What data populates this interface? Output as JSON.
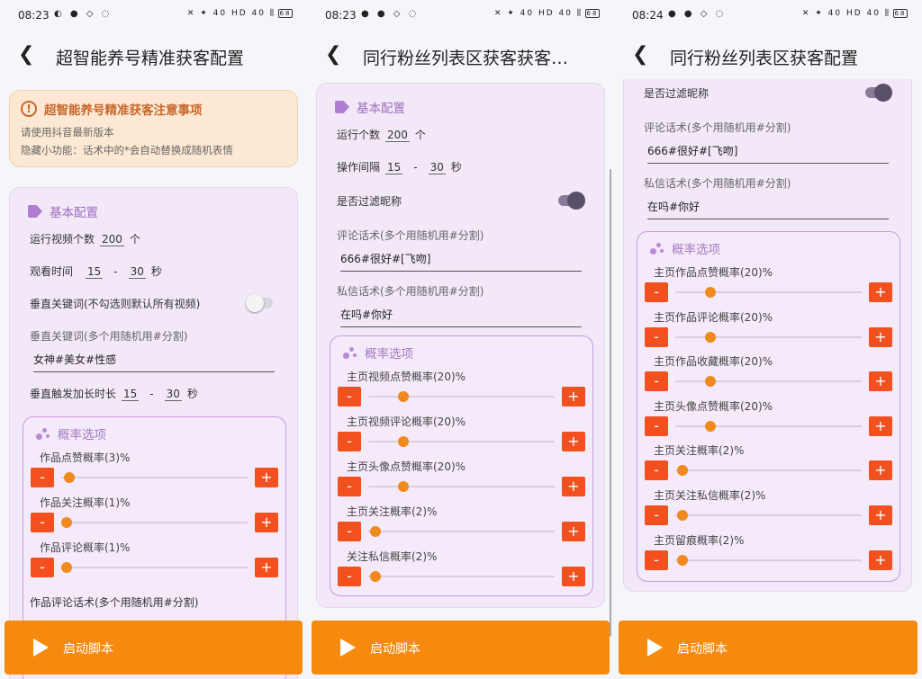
{
  "screens": [
    {
      "status": {
        "time": "08:23",
        "left_icons": "◐ ● ◇ ◌",
        "right_icons": "✕ ✦ 40 HD 40 ⫼",
        "battery": "68"
      },
      "title": "超智能养号精准获客配置",
      "notice": {
        "title": "超智能养号精准获客注意事项",
        "line1": "请使用抖音最新版本",
        "line2": "隐藏小功能：话术中的*会自动替换成随机表情"
      },
      "basic": {
        "title": "基本配置",
        "run_count_label": "运行视频个数",
        "run_count": "200",
        "run_count_unit": "个",
        "watch_label": "观看时间",
        "watch_min": "15",
        "watch_dash": "-",
        "watch_max": "30",
        "watch_unit": "秒",
        "vertical_kw_label": "垂直关键词(不勾选则默认所有视频)",
        "vertical_kw_on": false,
        "kw_field_label": "垂直关键词(多个用随机用#分割)",
        "kw_field_value": "女神#美女#性感",
        "trigger_label": "垂直触发加长时长",
        "trigger_min": "15",
        "trigger_dash": "-",
        "trigger_max": "30",
        "trigger_unit": "秒"
      },
      "prob": {
        "title": "概率选项",
        "items": [
          {
            "label": "作品点赞概率(3)%",
            "value": 3
          },
          {
            "label": "作品关注概率(1)%",
            "value": 1
          },
          {
            "label": "作品评论概率(1)%",
            "value": 1
          }
        ],
        "minus": "-",
        "plus": "+"
      },
      "comment_label": "作品评论话术(多个用随机用#分割)",
      "start_label": "启动脚本"
    },
    {
      "status": {
        "time": "08:23",
        "left_icons": "● ● ◇ ◌",
        "right_icons": "✕ ✦ 40 HD 40 ⫼",
        "battery": "68"
      },
      "title": "同行粉丝列表区获客获客…",
      "basic": {
        "title": "基本配置",
        "run_count_label": "运行个数",
        "run_count": "200",
        "run_count_unit": "个",
        "interval_label": "操作间隔",
        "interval_min": "15",
        "interval_dash": "-",
        "interval_max": "30",
        "interval_unit": "秒",
        "filter_label": "是否过滤昵称",
        "filter_on": true,
        "comment_label": "评论话术(多个用随机用#分割)",
        "comment_value": "666#很好#[飞吻]",
        "dm_label": "私信话术(多个用随机用#分割)",
        "dm_value": "在吗#你好"
      },
      "prob": {
        "title": "概率选项",
        "items": [
          {
            "label": "主页视频点赞概率(20)%",
            "value": 20
          },
          {
            "label": "主页视频评论概率(20)%",
            "value": 20
          },
          {
            "label": "主页头像点赞概率(20)%",
            "value": 20
          },
          {
            "label": "主页关注概率(2)%",
            "value": 2
          },
          {
            "label": "关注私信概率(2)%",
            "value": 2
          }
        ],
        "minus": "-",
        "plus": "+"
      },
      "start_label": "启动脚本"
    },
    {
      "status": {
        "time": "08:24",
        "left_icons": "● ● ◇ ◌",
        "right_icons": "✕ ✦ 40 HD 40 ⫼",
        "battery": "68"
      },
      "title": "同行粉丝列表区获客配置",
      "basic": {
        "filter_label": "是否过滤昵称",
        "filter_on": true,
        "comment_label": "评论话术(多个用随机用#分割)",
        "comment_value": "666#很好#[飞吻]",
        "dm_label": "私信话术(多个用随机用#分割)",
        "dm_value": "在吗#你好"
      },
      "prob": {
        "title": "概率选项",
        "items": [
          {
            "label": "主页作品点赞概率(20)%",
            "value": 20
          },
          {
            "label": "主页作品评论概率(20)%",
            "value": 20
          },
          {
            "label": "主页作品收藏概率(20)%",
            "value": 20
          },
          {
            "label": "主页头像点赞概率(20)%",
            "value": 20
          },
          {
            "label": "主页关注概率(2)%",
            "value": 2
          },
          {
            "label": "主页关注私信概率(2)%",
            "value": 2
          },
          {
            "label": "主页留痕概率(2)%",
            "value": 2
          }
        ],
        "minus": "-",
        "plus": "+"
      },
      "start_label": "启动脚本"
    }
  ],
  "colors": {
    "accent": "#f58a0f",
    "button": "#f2501f",
    "card": "#f3e8f8",
    "prob_border": "#c99be0",
    "notice_bg": "#fde9d3",
    "notice_text": "#c8662a"
  }
}
